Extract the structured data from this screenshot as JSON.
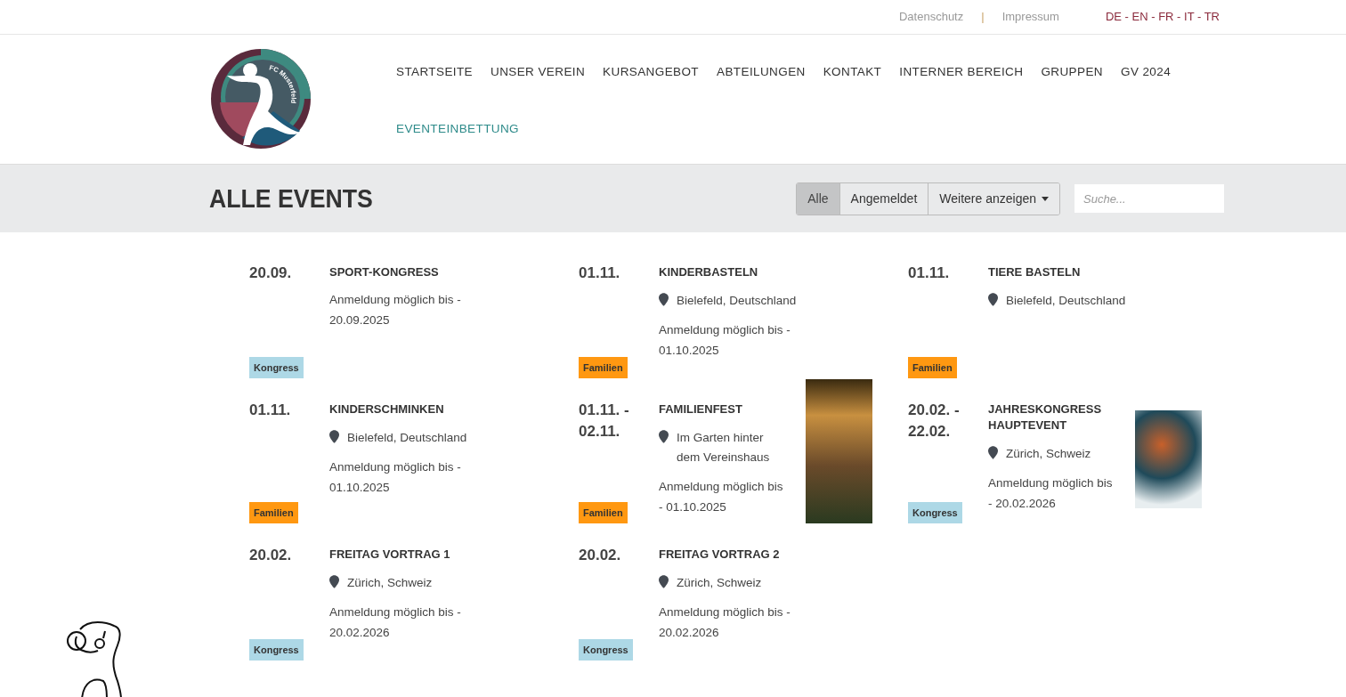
{
  "top_links": [
    "Datenschutz",
    "Impressum"
  ],
  "top_separator": "|",
  "languages": "DE - EN - FR - IT - TR",
  "logo": {
    "text": "FC Musterfeld"
  },
  "nav": [
    {
      "label": "STARTSEITE",
      "selected": false
    },
    {
      "label": "UNSER VEREIN",
      "selected": false
    },
    {
      "label": "KURSANGEBOT",
      "selected": false
    },
    {
      "label": "ABTEILUNGEN",
      "selected": false
    },
    {
      "label": "KONTAKT",
      "selected": false
    },
    {
      "label": "INTERNER BEREICH",
      "selected": false
    },
    {
      "label": "GRUPPEN",
      "selected": false
    },
    {
      "label": "GV 2024",
      "selected": false
    },
    {
      "label": "EVENTEINBETTUNG",
      "selected": true
    }
  ],
  "page_title": "ALLE EVENTS",
  "filters": [
    {
      "label": "Alle",
      "selected": true,
      "kind": "button"
    },
    {
      "label": "Angemeldet",
      "selected": false,
      "kind": "button"
    },
    {
      "label": "Weitere anzeigen",
      "selected": false,
      "kind": "dropdown"
    }
  ],
  "search": {
    "placeholder": "Suche..."
  },
  "events": [
    {
      "kind": "plain",
      "date": [
        "20.09."
      ],
      "title": [
        "SPORT-KONGRESS"
      ],
      "deadline": [
        "Anmeldung möglich bis -",
        "20.09.2025"
      ],
      "tag": {
        "label": "Kongress",
        "color": "#add8e6"
      }
    },
    {
      "kind": "plain",
      "date": [
        "01.11."
      ],
      "title": [
        "KINDERBASTELN"
      ],
      "location": [
        "Bielefeld, Deutschland"
      ],
      "deadline": [
        "Anmeldung möglich bis -",
        "01.10.2025"
      ],
      "tag": {
        "label": "Familien",
        "color": "#ff9811"
      }
    },
    {
      "kind": "plain",
      "date": [
        "01.11."
      ],
      "title": [
        "TIERE BASTELN"
      ],
      "location": [
        "Bielefeld, Deutschland"
      ],
      "tag": {
        "label": "Familien",
        "color": "#ff9811"
      }
    },
    {
      "kind": "plain",
      "date": [
        "01.11."
      ],
      "title": [
        "KINDERSCHMINKEN"
      ],
      "location": [
        "Bielefeld, Deutschland"
      ],
      "deadline": [
        "Anmeldung möglich bis -",
        "01.10.2025"
      ],
      "tag": {
        "label": "Familien",
        "color": "#ff9811"
      }
    },
    {
      "kind": "photo",
      "date": [
        "01.11. -",
        "02.11."
      ],
      "title": [
        "FAMILIENFEST"
      ],
      "location": [
        "Im Garten hinter",
        "dem Vereinshaus"
      ],
      "deadline": [
        "Anmeldung möglich bis",
        "- 01.10.2025"
      ],
      "tag": {
        "label": "Familien",
        "color": "#ff9811"
      }
    },
    {
      "kind": "illustration",
      "date": [
        "20.02. -",
        "22.02."
      ],
      "title": [
        "JAHRESKONGRESS",
        "HAUPTEVENT"
      ],
      "location": [
        "Zürich, Schweiz"
      ],
      "deadline": [
        "Anmeldung möglich bis",
        "- 20.02.2026"
      ],
      "tag": {
        "label": "Kongress",
        "color": "#add8e6"
      }
    },
    {
      "kind": "plain",
      "date": [
        "20.02."
      ],
      "title": [
        "FREITAG VORTRAG 1"
      ],
      "location": [
        "Zürich, Schweiz"
      ],
      "deadline": [
        "Anmeldung möglich bis -",
        "20.02.2026"
      ],
      "tag": {
        "label": "Kongress",
        "color": "#add8e6"
      }
    },
    {
      "kind": "plain",
      "date": [
        "20.02."
      ],
      "title": [
        "FREITAG VORTRAG 2"
      ],
      "location": [
        "Zürich, Schweiz"
      ],
      "deadline": [
        "Anmeldung möglich bis -",
        "20.02.2026"
      ],
      "tag": {
        "label": "Kongress",
        "color": "#add8e6"
      }
    }
  ]
}
